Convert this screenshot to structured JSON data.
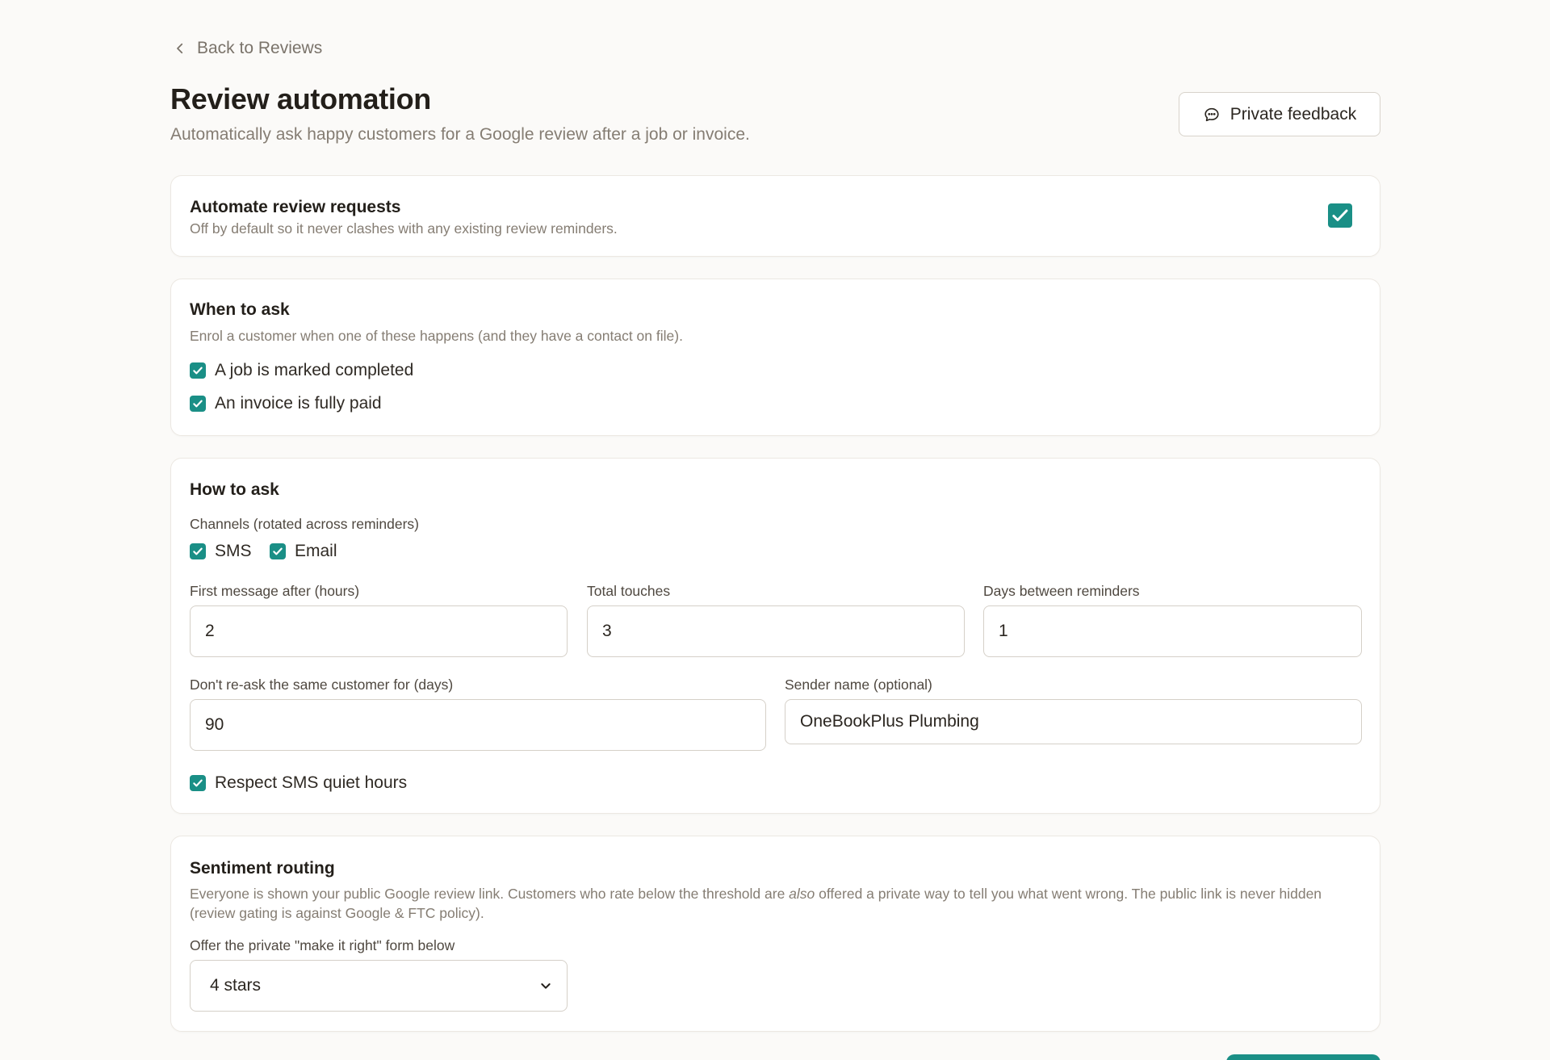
{
  "nav": {
    "back_label": "Back to Reviews"
  },
  "header": {
    "title": "Review automation",
    "subtitle": "Automatically ask happy customers for a Google review after a job or invoice.",
    "private_feedback_label": "Private feedback"
  },
  "automate": {
    "title": "Automate review requests",
    "description": "Off by default so it never clashes with any existing review reminders.",
    "checked": true
  },
  "when": {
    "title": "When to ask",
    "description": "Enrol a customer when one of these happens (and they have a contact on file).",
    "options": [
      {
        "label": "A job is marked completed",
        "checked": true
      },
      {
        "label": "An invoice is fully paid",
        "checked": true
      }
    ]
  },
  "how": {
    "title": "How to ask",
    "channels_label": "Channels (rotated across reminders)",
    "channels": [
      {
        "label": "SMS",
        "checked": true
      },
      {
        "label": "Email",
        "checked": true
      }
    ],
    "first_message_label": "First message after (hours)",
    "first_message_value": "2",
    "total_touches_label": "Total touches",
    "total_touches_value": "3",
    "days_between_label": "Days between reminders",
    "days_between_value": "1",
    "reask_label": "Don't re-ask the same customer for (days)",
    "reask_value": "90",
    "sender_label": "Sender name (optional)",
    "sender_value": "OneBookPlus Plumbing",
    "quiet_hours_label": "Respect SMS quiet hours",
    "quiet_hours_checked": true
  },
  "sentiment": {
    "title": "Sentiment routing",
    "description_before": "Everyone is shown your public Google review link. Customers who rate below the threshold are ",
    "description_emphasis": "also",
    "description_after": " offered a private way to tell you what went wrong. The public link is never hidden (review gating is against Google & FTC policy).",
    "offer_label": "Offer the private \"make it right\" form below",
    "threshold_value": "4 stars"
  },
  "colors": {
    "accent": "#1a8f86"
  }
}
